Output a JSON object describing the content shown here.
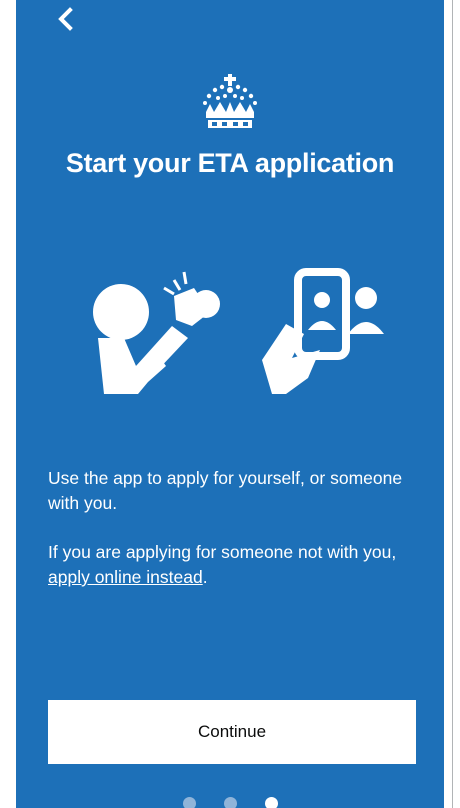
{
  "header": {
    "back_label": "Back"
  },
  "main": {
    "title": "Start your ETA application",
    "paragraph_1": "Use the app to apply for yourself, or someone with you.",
    "paragraph_2_prefix": "If you are applying for someone not with you, ",
    "paragraph_2_link": "apply online instead",
    "paragraph_2_suffix": "."
  },
  "footer": {
    "continue_label": "Continue",
    "pagination": {
      "total": 3,
      "current": 3
    }
  },
  "icons": [
    "back-chevron-icon",
    "crown-icon",
    "selfie-person-icon",
    "phone-photo-person-icon"
  ],
  "colors": {
    "background": "#1d70b8",
    "text": "#ffffff",
    "button_bg": "#ffffff",
    "button_text": "#0b0c0c"
  }
}
